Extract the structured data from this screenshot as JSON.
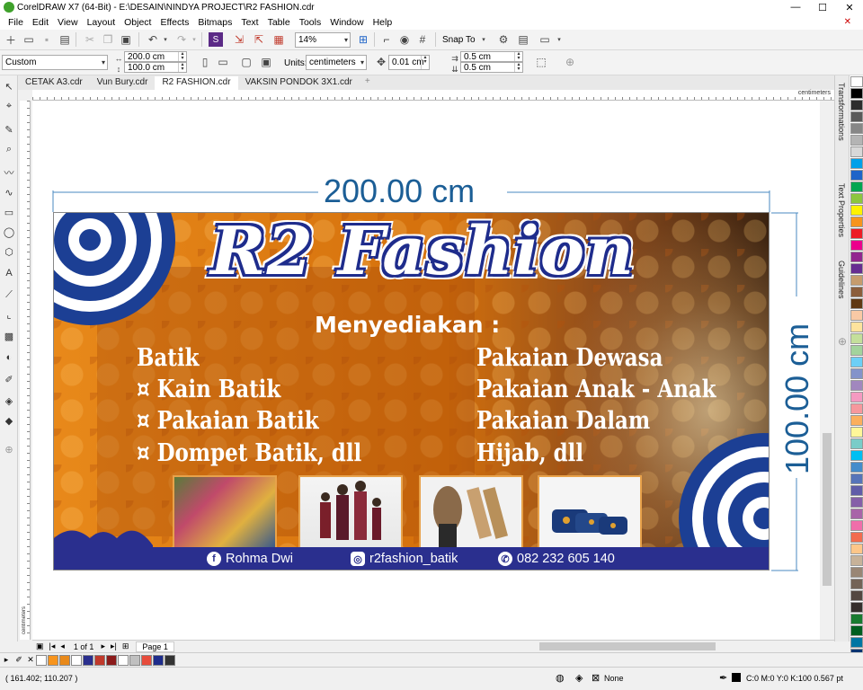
{
  "window": {
    "title": "CorelDRAW X7 (64-Bit) - E:\\DESAIN\\NINDYA PROJECT\\R2 FASHION.cdr",
    "minimize": "—",
    "maximize": "☐",
    "close": "✕"
  },
  "menu": [
    "File",
    "Edit",
    "View",
    "Layout",
    "Object",
    "Effects",
    "Bitmaps",
    "Text",
    "Table",
    "Tools",
    "Window",
    "Help"
  ],
  "standard_toolbar": {
    "zoom": "14%",
    "snap_to": "Snap To"
  },
  "property_bar": {
    "page_size": "Custom",
    "width": "200.0 cm",
    "height": "100.0 cm",
    "units_label": "Units:",
    "units": "centimeters",
    "nudge": "0.01 cm",
    "dup_x": "0.5 cm",
    "dup_y": "0.5 cm"
  },
  "document_tabs": [
    {
      "label": "CETAK A3.cdr",
      "active": false
    },
    {
      "label": "Vun Bury.cdr",
      "active": false
    },
    {
      "label": "R2 FASHION.cdr",
      "active": true
    },
    {
      "label": "VAKSIN PONDOK 3X1.cdr",
      "active": false
    }
  ],
  "ruler": {
    "unit": "centimeters"
  },
  "dockers": [
    "Transformations",
    "Text Properties",
    "Guidelines"
  ],
  "dimensions": {
    "width_label": "200.00 cm",
    "height_label": "100.00 cm"
  },
  "banner": {
    "brand": "R2 Fashion",
    "subheading": "Menyediakan :",
    "left_items": [
      "Batik",
      "¤ Kain Batik",
      "¤ Pakaian Batik",
      "¤ Dompet Batik, dll"
    ],
    "right_items": [
      "Pakaian Dewasa",
      "Pakaian Anak - Anak",
      "Pakaian Dalam",
      "Hijab,  dll"
    ],
    "footer": {
      "facebook": "Rohma Dwi",
      "instagram": "r2fashion_batik",
      "phone": "082 232 605 140"
    },
    "colors": {
      "orange": "#e8891a",
      "navy": "#2a2f8e",
      "brand_outline": "#1e2c8c"
    }
  },
  "page_nav": {
    "page_count": "1 of 1",
    "page_tab": "Page 1"
  },
  "status": {
    "cursor": "( 161.402; 110.207 )",
    "fill": "None",
    "outline": "C:0 M:0 Y:0 K:100  0.567 pt"
  },
  "palette_colors": [
    "#ffffff",
    "#000000",
    "#2d2d2d",
    "#5a5a5a",
    "#878787",
    "#b4b4b4",
    "#d8d8d8",
    "#00a0e9",
    "#1e64c8",
    "#00a651",
    "#8dc63f",
    "#fff200",
    "#f7941d",
    "#ed1c24",
    "#ec008c",
    "#92278f",
    "#662d91",
    "#c69c6d",
    "#8b5e3c",
    "#603913",
    "#f9c9a5",
    "#fde39d",
    "#c4df9b",
    "#a3d39c",
    "#6dcff6",
    "#8493ca",
    "#a187be",
    "#f49ac1",
    "#f6989d",
    "#fbaf5d",
    "#fff799",
    "#7accc8",
    "#00bff3",
    "#448ccb",
    "#5674b9",
    "#605ca8",
    "#8560a8",
    "#a864a8",
    "#f06eaa",
    "#f26c4f",
    "#fdc689",
    "#c7b299",
    "#998675",
    "#736357",
    "#534741",
    "#362f2d",
    "#197b30",
    "#005e20",
    "#0076a3",
    "#003471"
  ],
  "doc_palette": [
    "#ffffff",
    "#f7941d",
    "#e8891a",
    "#ffffff",
    "#2a2f8e",
    "#c0392b",
    "#8b1a1a",
    "#ffffff",
    "#c0c0c0",
    "#e74c3c",
    "#1e2c8c",
    "#333333"
  ]
}
